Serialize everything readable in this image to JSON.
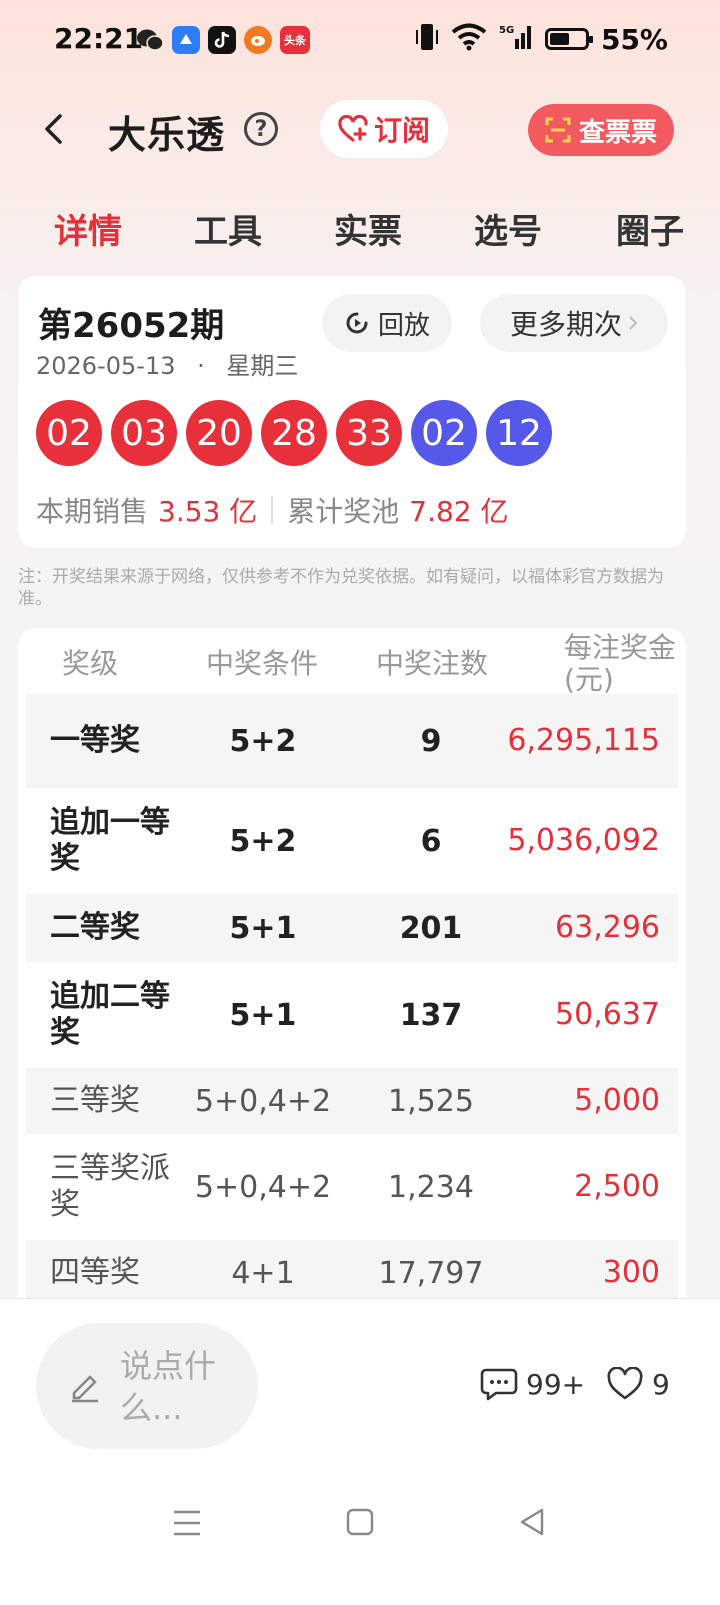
{
  "status_bar": {
    "time": "22:21",
    "battery_pct": "55%",
    "battery_level": 0.55,
    "network": "5G",
    "app_icons": [
      "wechat-icon",
      "cloud-app-icon",
      "tiktok-icon",
      "weibo-icon",
      "toutiao-icon"
    ],
    "toutiao_label": "头条"
  },
  "header": {
    "title": "大乐透",
    "help": "?",
    "subscribe_label": "订阅",
    "check_ticket_label": "查票票"
  },
  "tabs": [
    {
      "label": "详情",
      "active": true
    },
    {
      "label": "工具",
      "active": false
    },
    {
      "label": "实票",
      "active": false
    },
    {
      "label": "选号",
      "active": false
    },
    {
      "label": "圈子",
      "active": false
    }
  ],
  "draw": {
    "issue": "第26052期",
    "date": "2026-05-13",
    "dot": "·",
    "weekday": "星期三",
    "replay_label": "回放",
    "more_label": "更多期次",
    "red_balls": [
      "02",
      "03",
      "20",
      "28",
      "33"
    ],
    "blue_balls": [
      "02",
      "12"
    ],
    "sales_label": "本期销售",
    "sales_value": "3.53 亿",
    "pool_label": "累计奖池",
    "pool_value": "7.82 亿"
  },
  "note": "注：开奖结果来源于网络，仅供参考不作为兑奖依据。如有疑问，以福体彩官方数据为准。",
  "prize_table": {
    "headers": [
      "奖级",
      "中奖条件",
      "中奖注数",
      "每注奖金(元)"
    ],
    "rows": [
      {
        "level": "一等奖",
        "condition": "5+2",
        "count": "9",
        "amount": "6,295,115"
      },
      {
        "level": "追加一等奖",
        "condition": "5+2",
        "count": "6",
        "amount": "5,036,092"
      },
      {
        "level": "二等奖",
        "condition": "5+1",
        "count": "201",
        "amount": "63,296"
      },
      {
        "level": "追加二等奖",
        "condition": "5+1",
        "count": "137",
        "amount": "50,637"
      },
      {
        "level": "三等奖",
        "condition": "5+0,4+2",
        "count": "1,525",
        "amount": "5,000"
      },
      {
        "level": "三等奖派奖",
        "condition": "5+0,4+2",
        "count": "1,234",
        "amount": "2,500"
      },
      {
        "level": "四等奖",
        "condition": "4+1",
        "count": "17,797",
        "amount": "300"
      }
    ]
  },
  "bottom_bar": {
    "comment_placeholder": "说点什么...",
    "comment_count": "99+",
    "like_count": "9"
  },
  "colors": {
    "accent_red": "#e3303a",
    "ball_red": "#e8303a",
    "ball_blue": "#5558e8",
    "check_btn": "#f25a60"
  }
}
